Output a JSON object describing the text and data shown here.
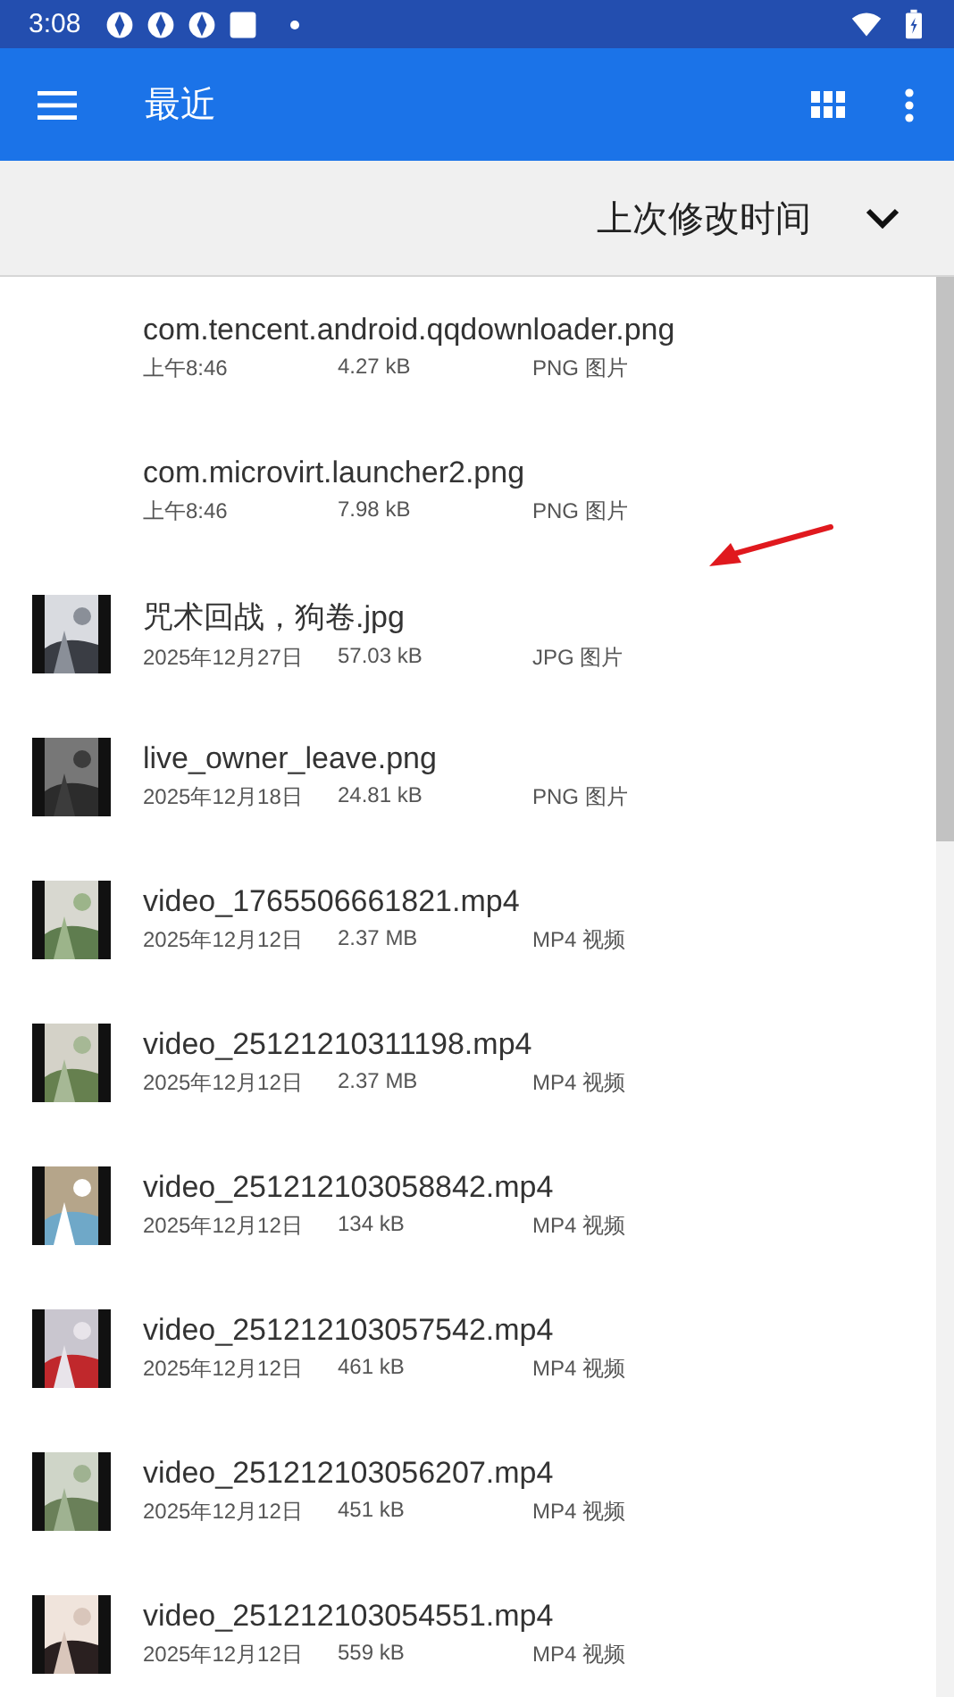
{
  "status_bar": {
    "time": "3:08"
  },
  "app_bar": {
    "title": "最近"
  },
  "sort_bar": {
    "label": "上次修改时间"
  },
  "files": [
    {
      "name": "com.tencent.android.qqdownloader.png",
      "date": "上午8:46",
      "size": "4.27 kB",
      "type": "PNG 图片"
    },
    {
      "name": "com.microvirt.launcher2.png",
      "date": "上午8:46",
      "size": "7.98 kB",
      "type": "PNG 图片"
    },
    {
      "name": "咒术回战，狗卷.jpg",
      "date": "2025年12月27日",
      "size": "57.03 kB",
      "type": "JPG 图片"
    },
    {
      "name": "live_owner_leave.png",
      "date": "2025年12月18日",
      "size": "24.81 kB",
      "type": "PNG 图片"
    },
    {
      "name": "video_1765506661821.mp4",
      "date": "2025年12月12日",
      "size": "2.37 MB",
      "type": "MP4 视频"
    },
    {
      "name": "video_25121210311198.mp4",
      "date": "2025年12月12日",
      "size": "2.37 MB",
      "type": "MP4 视频"
    },
    {
      "name": "video_251212103058842.mp4",
      "date": "2025年12月12日",
      "size": "134 kB",
      "type": "MP4 视频"
    },
    {
      "name": "video_251212103057542.mp4",
      "date": "2025年12月12日",
      "size": "461 kB",
      "type": "MP4 视频"
    },
    {
      "name": "video_251212103056207.mp4",
      "date": "2025年12月12日",
      "size": "451 kB",
      "type": "MP4 视频"
    },
    {
      "name": "video_251212103054551.mp4",
      "date": "2025年12月12日",
      "size": "559 kB",
      "type": "MP4 视频"
    }
  ]
}
